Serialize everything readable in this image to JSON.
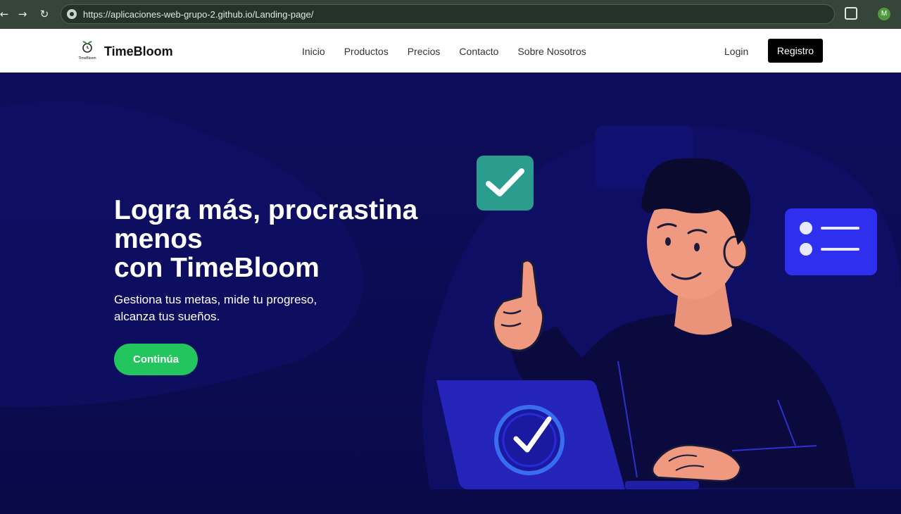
{
  "browser": {
    "url": "https://aplicaciones-web-grupo-2.github.io/Landing-page/",
    "avatar_letter": "M"
  },
  "nav": {
    "brand": "TimeBloom",
    "logo_caption": "TimeBloom",
    "links": [
      "Inicio",
      "Productos",
      "Precios",
      "Contacto",
      "Sobre Nosotros"
    ],
    "login": "Login",
    "signup": "Registro"
  },
  "hero": {
    "title_lines": [
      "Logra más, procrastina",
      "menos",
      "con TimeBloom"
    ],
    "subtitle_lines": [
      "Gestiona tus metas, mide tu progreso,",
      "alcanza tus sueños."
    ],
    "cta": "Continúa"
  },
  "colors": {
    "hero_bg": "#0b0b52",
    "cta": "#22c55e",
    "signup_bg": "#000000",
    "card_teal": "#2a9d8f",
    "card_blue": "#2f2ff0"
  }
}
